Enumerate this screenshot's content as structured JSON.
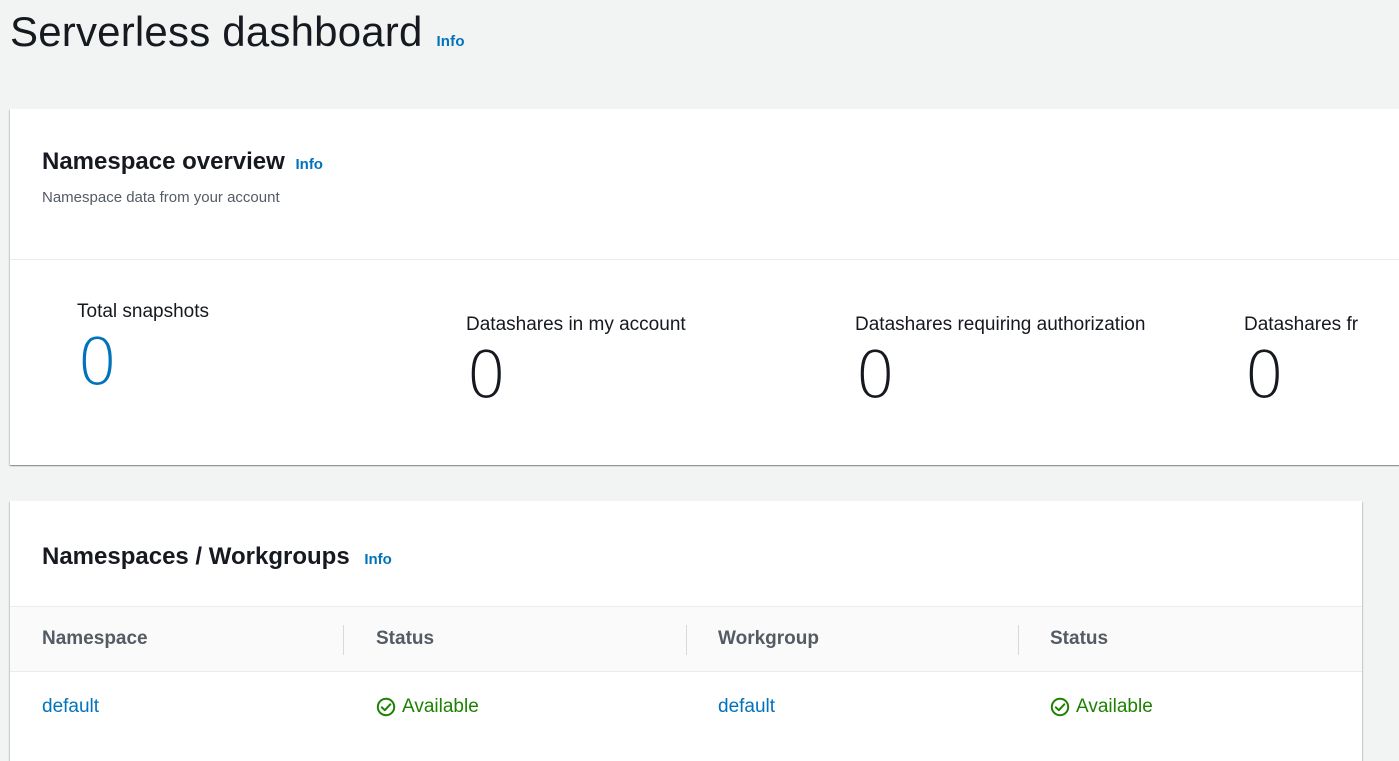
{
  "page": {
    "title": "Serverless dashboard",
    "info": "Info"
  },
  "overview": {
    "title": "Namespace overview",
    "info": "Info",
    "description": "Namespace data from your account",
    "metrics": [
      {
        "label": "Total snapshots",
        "value": "0"
      },
      {
        "label": "Datashares in my account",
        "value": "0"
      },
      {
        "label": "Datashares requiring authorization",
        "value": "0"
      },
      {
        "label": "Datashares fr",
        "value": "0"
      }
    ]
  },
  "namespaces": {
    "title": "Namespaces / Workgroups",
    "info": "Info",
    "columns": [
      "Namespace",
      "Status",
      "Workgroup",
      "Status"
    ],
    "rows": [
      {
        "namespace": "default",
        "namespace_status": "Available",
        "workgroup": "default",
        "workgroup_status": "Available"
      }
    ]
  },
  "colors": {
    "link": "#0073bb",
    "success": "#1d8102",
    "background": "#f2f3f3"
  },
  "icons": {
    "status_available": "check-circle-icon"
  }
}
